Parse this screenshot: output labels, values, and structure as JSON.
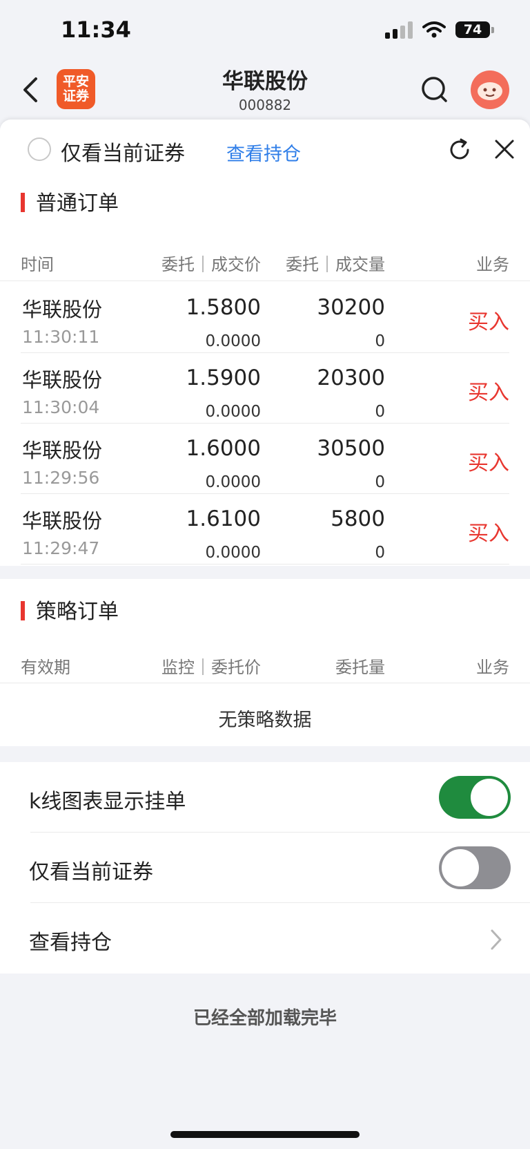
{
  "status_bar": {
    "time": "11:34",
    "battery": "74"
  },
  "nav": {
    "title": "华联股份",
    "code": "000882",
    "logo_line1": "平安",
    "logo_line2": "证券"
  },
  "filter_bar": {
    "only_current_label": "仅看当前证券",
    "view_holdings_label": "查看持仓"
  },
  "normal_orders": {
    "title": "普通订单",
    "headers": {
      "time": "时间",
      "price": "委托｜成交价",
      "qty": "委托｜成交量",
      "biz": "业务"
    },
    "rows": [
      {
        "name": "华联股份",
        "time": "11:30:11",
        "price": "1.5800",
        "deal_price": "0.0000",
        "qty": "30200",
        "deal_qty": "0",
        "biz": "买入"
      },
      {
        "name": "华联股份",
        "time": "11:30:04",
        "price": "1.5900",
        "deal_price": "0.0000",
        "qty": "20300",
        "deal_qty": "0",
        "biz": "买入"
      },
      {
        "name": "华联股份",
        "time": "11:29:56",
        "price": "1.6000",
        "deal_price": "0.0000",
        "qty": "30500",
        "deal_qty": "0",
        "biz": "买入"
      },
      {
        "name": "华联股份",
        "time": "11:29:47",
        "price": "1.6100",
        "deal_price": "0.0000",
        "qty": "5800",
        "deal_qty": "0",
        "biz": "买入"
      }
    ]
  },
  "strategy_orders": {
    "title": "策略订单",
    "headers": {
      "validity": "有效期",
      "price": "监控｜委托价",
      "qty": "委托量",
      "biz": "业务"
    },
    "empty": "无策略数据"
  },
  "settings": {
    "kline_label": "k线图表显示挂单",
    "kline_on": true,
    "only_current_label": "仅看当前证券",
    "only_current_on": false,
    "holdings_label": "查看持仓"
  },
  "footer": "已经全部加载完毕",
  "colors": {
    "accent_red": "#e8362f",
    "link_blue": "#2f7ee8",
    "toggle_green": "#1f8b3e",
    "brand_orange": "#f05a28"
  }
}
